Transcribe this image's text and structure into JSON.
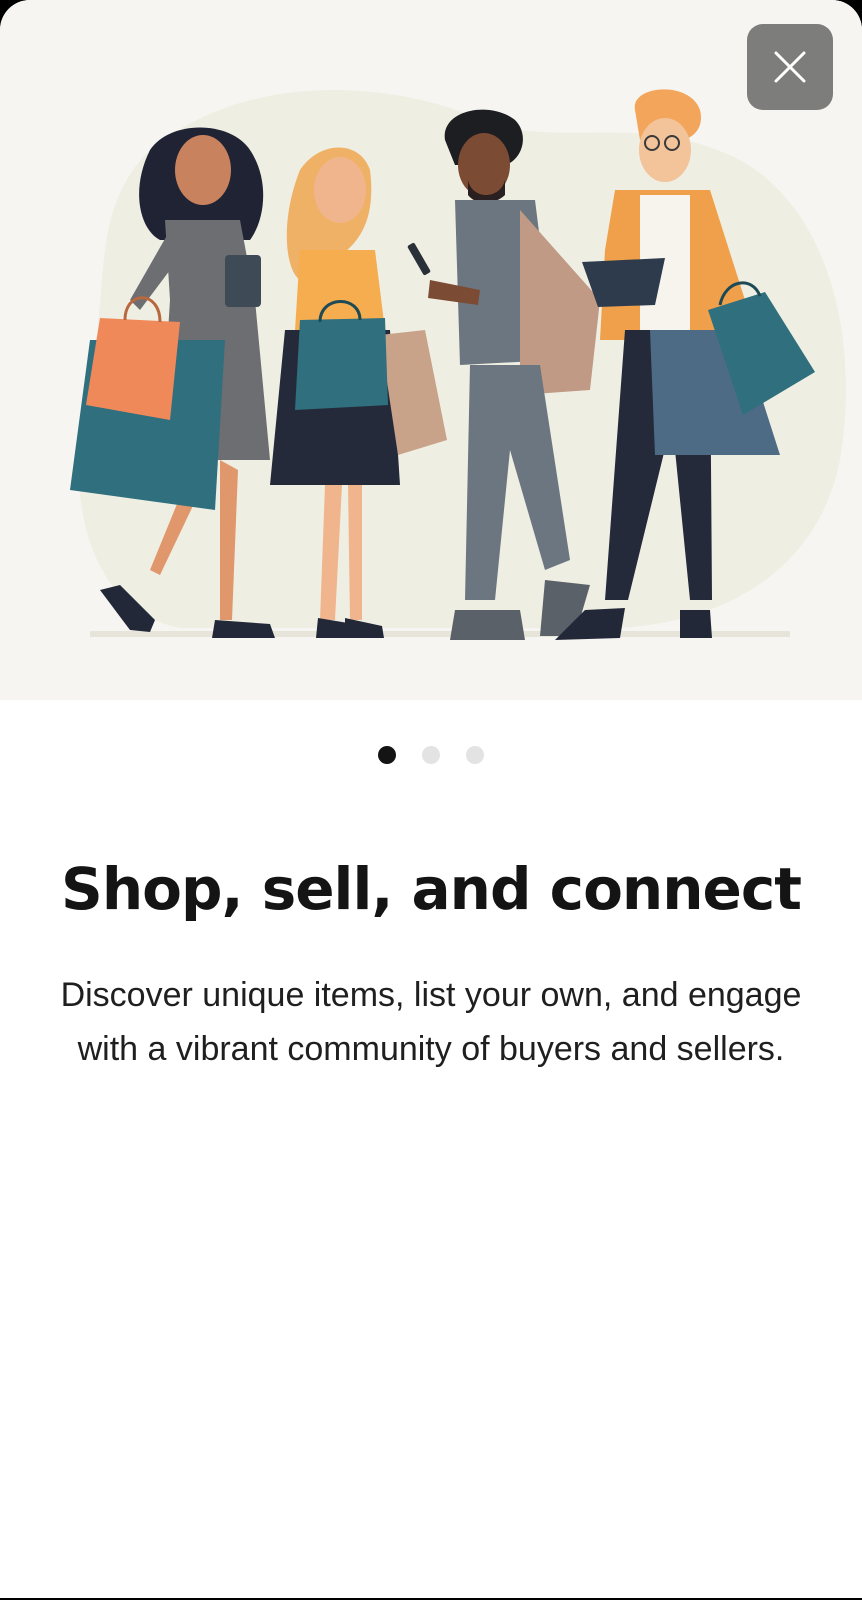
{
  "onboarding": {
    "close_icon": "close-icon",
    "illustration": "group of shoppers with shopping bags",
    "pagination": {
      "total": 3,
      "active_index": 0
    },
    "title": "Shop, sell, and connect",
    "description": "Discover unique items, list your own, and engage with a vibrant community of buyers and sellers."
  },
  "colors": {
    "background": "#ffffff",
    "hero_background": "#f6f5f1",
    "close_button": "#7d7d7b",
    "dot_active": "#141414",
    "dot_inactive": "#e3e3e3",
    "teal": "#2f6f7e",
    "orange": "#f0895a",
    "navy": "#242a3a"
  }
}
